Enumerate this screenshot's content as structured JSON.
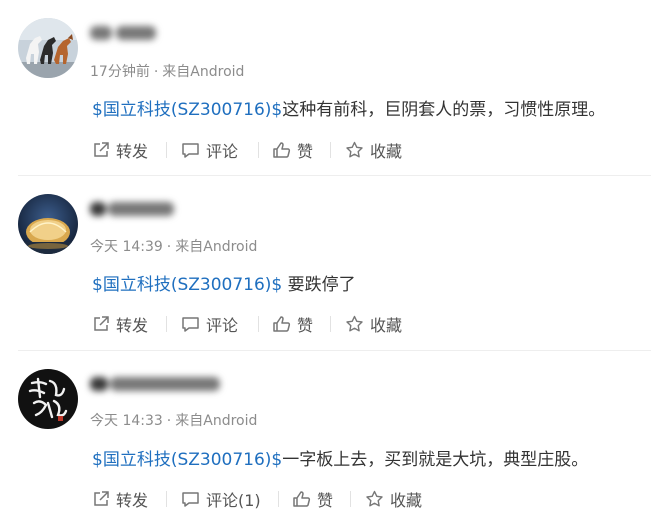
{
  "posts": [
    {
      "time": "17分钟前",
      "source": "来自Android",
      "stock_tag": "$国立科技(SZ300716)$",
      "text": "这种有前科，巨阴套人的票，习惯性原理。",
      "actions": {
        "repost": "转发",
        "comment": "评论",
        "like": "赞",
        "favorite": "收藏"
      }
    },
    {
      "time": "今天 14:39",
      "source": "来自Android",
      "stock_tag": "$国立科技(SZ300716)$",
      "text": " 要跌停了",
      "actions": {
        "repost": "转发",
        "comment": "评论",
        "like": "赞",
        "favorite": "收藏"
      }
    },
    {
      "time": "今天 14:33",
      "source": "来自Android",
      "stock_tag": "$国立科技(SZ300716)$",
      "text": "一字板上去，买到就是大坑，典型庄股。",
      "actions": {
        "repost": "转发",
        "comment": "评论(1)",
        "like": "赞",
        "favorite": "收藏"
      }
    }
  ],
  "meta_separator": "·",
  "avatars": {
    "post1": "horses-avatar",
    "post2": "building-avatar",
    "post3": "calligraphy-avatar",
    "post3_text": "乘风破浪"
  },
  "colors": {
    "link": "#1f6fbf",
    "meta": "#8c8c8c",
    "text": "#333333",
    "action": "#555555",
    "divider": "#eeeeee"
  }
}
